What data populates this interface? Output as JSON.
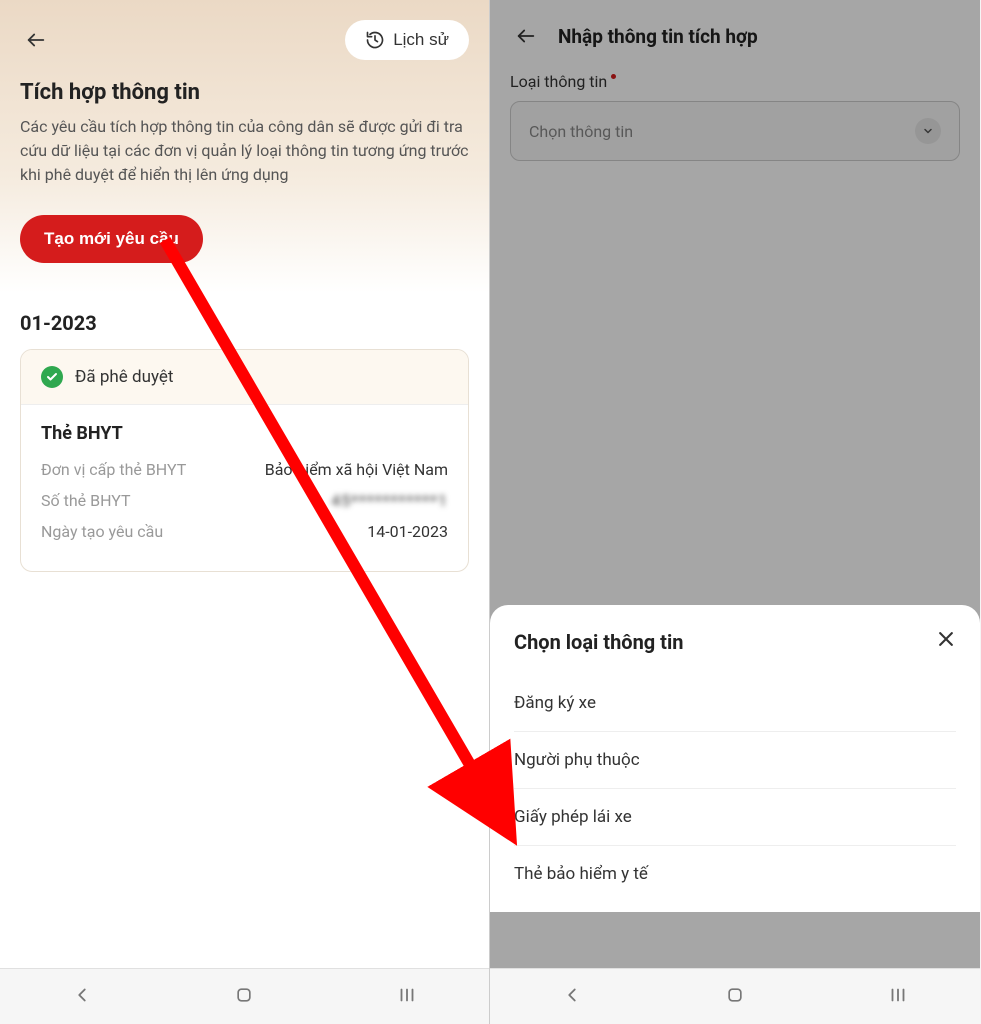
{
  "left": {
    "history_button": "Lịch sử",
    "title": "Tích hợp thông tin",
    "description": "Các yêu cầu tích hợp thông tin của công dân sẽ được gửi đi tra cứu dữ liệu tại các đơn vị quản lý loại thông tin tương ứng trước khi phê duyệt để hiển thị lên ứng dụng",
    "create_button": "Tạo mới yêu cầu",
    "date_group": "01-2023",
    "card": {
      "status": "Đã phê duyệt",
      "title": "Thẻ BHYT",
      "rows": [
        {
          "label": "Đơn vị cấp thẻ BHYT",
          "value": "Bảo hiểm xã hội Việt Nam"
        },
        {
          "label": "Số thẻ BHYT",
          "value": "45***********1"
        },
        {
          "label": "Ngày tạo yêu cầu",
          "value": "14-01-2023"
        }
      ]
    }
  },
  "right": {
    "title": "Nhập thông tin tích hợp",
    "field_label": "Loại thông tin",
    "placeholder": "Chọn thông tin",
    "sheet": {
      "title": "Chọn loại thông tin",
      "options": [
        "Đăng ký xe",
        "Người phụ thuộc",
        "Giấy phép lái xe",
        "Thẻ bảo hiểm y tế"
      ]
    }
  }
}
